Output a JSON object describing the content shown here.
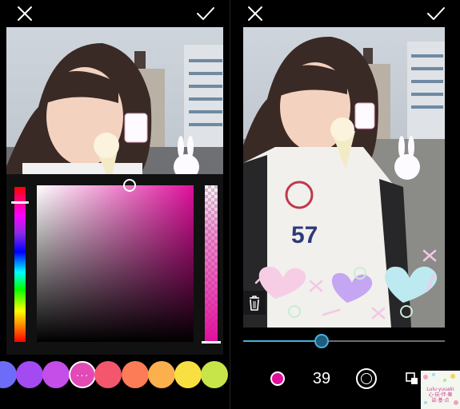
{
  "left": {
    "close_icon": "close-x-icon",
    "confirm_icon": "checkmark-icon",
    "picker": {
      "selected_color": "#e0109c",
      "hue_level": 0.09,
      "saturation": 0.6,
      "brightness": 0.97,
      "opacity": 1.0
    },
    "swatches": [
      {
        "color": "#6d6cf8"
      },
      {
        "color": "#a34af3"
      },
      {
        "color": "#c64ee8"
      },
      {
        "color": "#e24ab6",
        "selected": true,
        "more_label": "···"
      },
      {
        "color": "#f4566e"
      },
      {
        "color": "#fb7c56"
      },
      {
        "color": "#fbb04d"
      },
      {
        "color": "#f9e042"
      },
      {
        "color": "#c7e549"
      }
    ]
  },
  "right": {
    "close_icon": "close-x-icon",
    "confirm_icon": "checkmark-icon",
    "brush_color": "#e0109c",
    "brush_size": "39",
    "brush_size_level": 0.39,
    "brush_shape_icon": "circle-brush-icon",
    "eraser_icon": "eraser-icon",
    "trash_icon": "trash-icon",
    "accent_color": "#49b0df"
  },
  "watermark": {
    "text_line1": "Lulu·yuuaki",
    "text_line2": "心·玩·伴·樂",
    "text_line3": "誌·基·点"
  }
}
